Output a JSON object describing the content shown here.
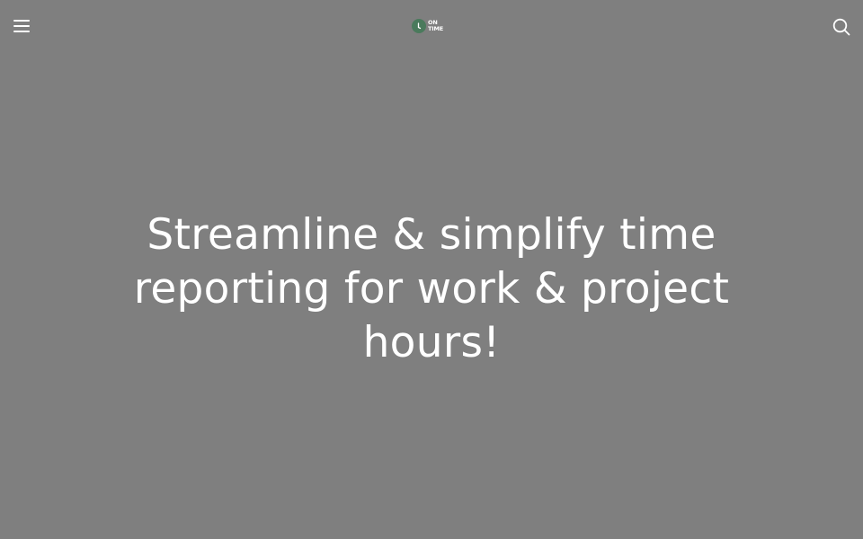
{
  "colors": {
    "background": "#7f7f7f",
    "text": "#ffffff",
    "logo_accent": "#4a7a5c"
  },
  "header": {
    "menu_icon": "hamburger-menu-icon",
    "search_icon": "search-icon",
    "logo": {
      "line1": "ON",
      "line2": "TIME"
    }
  },
  "hero": {
    "title": "Streamline & simplify time reporting for work & project hours!"
  }
}
